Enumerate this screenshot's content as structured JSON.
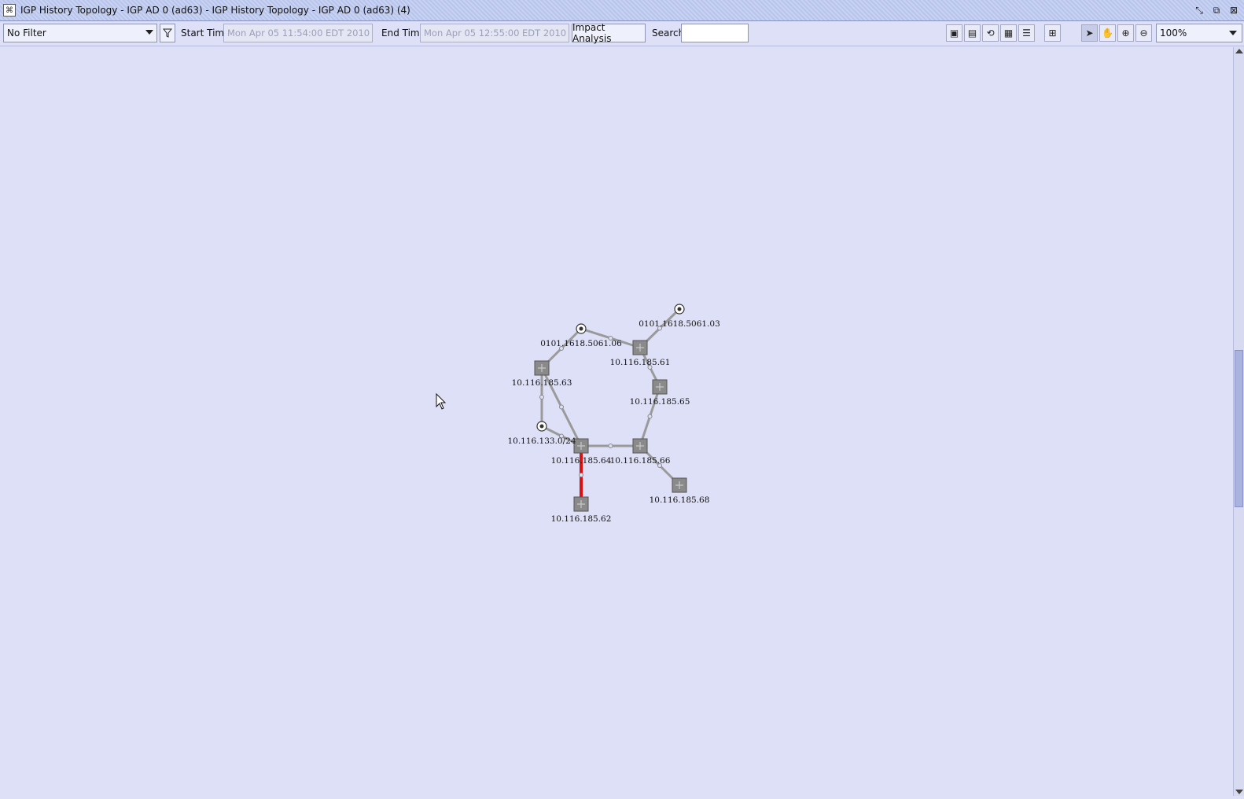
{
  "window": {
    "title": "IGP History Topology - IGP AD 0 (ad63) - IGP History Topology - IGP AD 0 (ad63) (4)",
    "app_icon": "topology-icon"
  },
  "toolbar": {
    "filter_value": "No Filter",
    "start_label": "Start Time",
    "start_value": "Mon Apr 05 11:54:00 EDT 2010",
    "end_label": "End Time",
    "end_value": "Mon Apr 05 12:55:00 EDT 2010",
    "impact_label": "Impact Analysis",
    "search_label": "Search",
    "search_value": "",
    "zoom_value": "100%",
    "icons": [
      "save-icon",
      "export-icon",
      "refresh-icon",
      "properties-icon",
      "legend-icon",
      "layout-icon",
      "select-icon",
      "pan-icon",
      "zoom-in-icon",
      "zoom-out-icon"
    ]
  },
  "topology": {
    "nodes": [
      {
        "id": "n63",
        "label": "10.116.185.63",
        "kind": "router"
      },
      {
        "id": "n61",
        "label": "10.116.185.61",
        "kind": "router"
      },
      {
        "id": "n65",
        "label": "10.116.185.65",
        "kind": "router"
      },
      {
        "id": "n64",
        "label": "10.116.185.64",
        "kind": "router"
      },
      {
        "id": "n66",
        "label": "10.116.185.66",
        "kind": "router"
      },
      {
        "id": "n68",
        "label": "10.116.185.68",
        "kind": "router"
      },
      {
        "id": "n62",
        "label": "10.116.185.62",
        "kind": "router"
      },
      {
        "id": "p06",
        "label": "0101.1618.5061.06",
        "kind": "pseudonode"
      },
      {
        "id": "p03",
        "label": "0101.1618.5061.03",
        "kind": "pseudonode"
      },
      {
        "id": "s133",
        "label": "10.116.133.0/24",
        "kind": "subnet"
      }
    ],
    "links": [
      {
        "from": "n63",
        "to": "p06",
        "status": "normal"
      },
      {
        "from": "p06",
        "to": "n61",
        "status": "normal"
      },
      {
        "from": "n61",
        "to": "p03",
        "status": "normal"
      },
      {
        "from": "n61",
        "to": "n65",
        "status": "normal"
      },
      {
        "from": "n65",
        "to": "n66",
        "status": "normal"
      },
      {
        "from": "n63",
        "to": "s133",
        "status": "normal"
      },
      {
        "from": "n63",
        "to": "n64",
        "status": "normal"
      },
      {
        "from": "s133",
        "to": "n64",
        "status": "normal"
      },
      {
        "from": "n64",
        "to": "n66",
        "status": "normal"
      },
      {
        "from": "n66",
        "to": "n68",
        "status": "normal"
      },
      {
        "from": "n64",
        "to": "n62",
        "status": "failed"
      }
    ],
    "colors": {
      "normal_link": "#9a9a9a",
      "failed_link": "#e01010",
      "router_fill": "#8a8a8a"
    }
  }
}
